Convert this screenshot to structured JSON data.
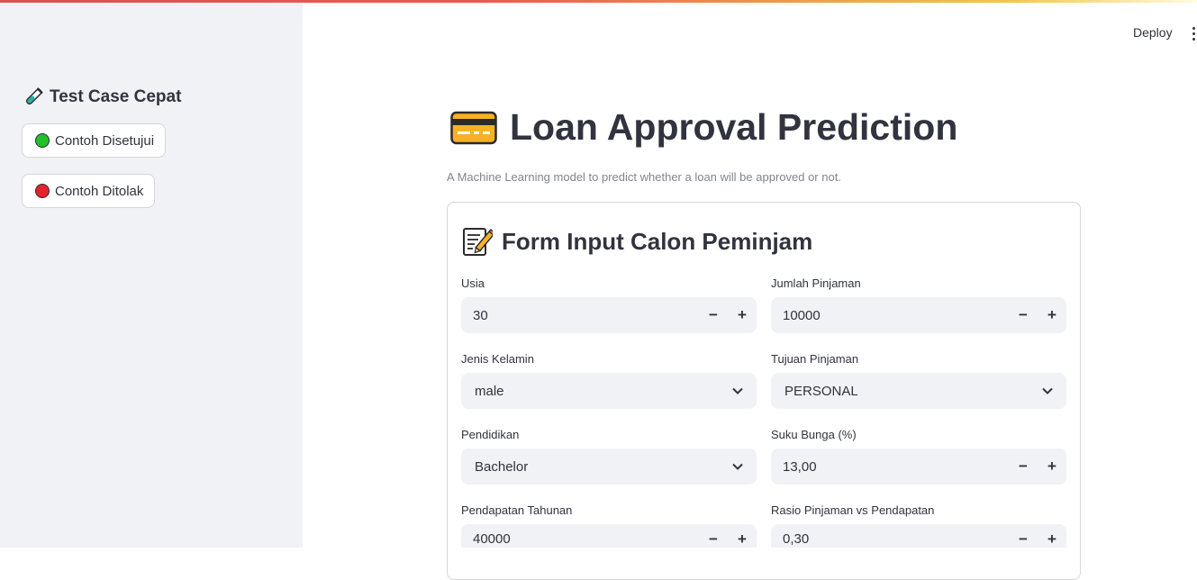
{
  "sidebar": {
    "title": "Test Case Cepat",
    "title_icon": "test-tube-icon",
    "buttons": [
      {
        "label": "Contoh Disetujui",
        "icon": "green-circle-icon",
        "color": "#22c02a"
      },
      {
        "label": "Contoh Ditolak",
        "icon": "red-circle-icon",
        "color": "#e3242b"
      }
    ]
  },
  "header": {
    "deploy_label": "Deploy",
    "menu_icon": "kebab-menu-icon"
  },
  "main": {
    "title": "Loan Approval Prediction",
    "title_icon": "credit-card-icon",
    "subtitle": "A Machine Learning model to predict whether a loan will be approved or not."
  },
  "form": {
    "title": "Form Input Calon Peminjam",
    "title_icon": "memo-icon",
    "fields": {
      "usia": {
        "label": "Usia",
        "value": "30"
      },
      "jumlah_pinjaman": {
        "label": "Jumlah Pinjaman",
        "value": "10000"
      },
      "jenis_kelamin": {
        "label": "Jenis Kelamin",
        "value": "male"
      },
      "tujuan_pinjaman": {
        "label": "Tujuan Pinjaman",
        "value": "PERSONAL"
      },
      "pendidikan": {
        "label": "Pendidikan",
        "value": "Bachelor"
      },
      "suku_bunga": {
        "label": "Suku Bunga (%)",
        "value": "13,00"
      },
      "pendapatan_tahunan": {
        "label": "Pendapatan Tahunan",
        "value": "40000"
      },
      "rasio": {
        "label": "Rasio Pinjaman vs Pendapatan",
        "value": "0,30"
      }
    },
    "stepper_minus": "−",
    "stepper_plus": "+"
  },
  "colors": {
    "sidebar_bg": "#f0f2f6",
    "field_bg": "#f0f2f6",
    "text": "#31333f",
    "muted": "#808495"
  }
}
